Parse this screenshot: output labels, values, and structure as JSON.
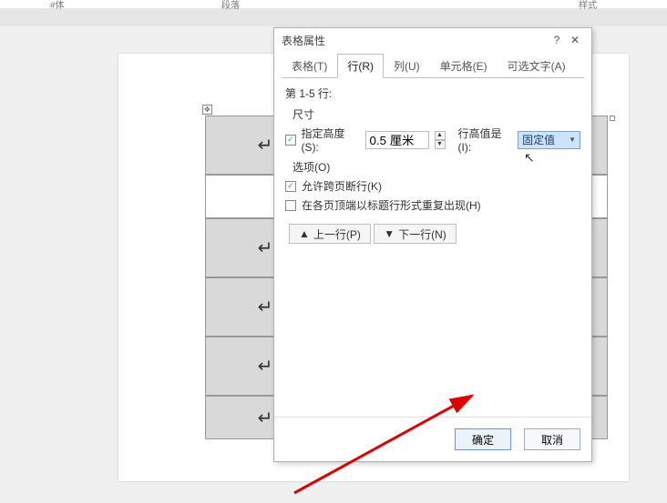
{
  "ribbon": {
    "left": "#体",
    "mid": "段落",
    "right": "样式"
  },
  "dialog": {
    "title": "表格属性",
    "help": "?",
    "tabs": {
      "table": "表格(T)",
      "row": "行(R)",
      "col": "列(U)",
      "cell": "单元格(E)",
      "alt": "可选文字(A)"
    },
    "range": "第 1-5 行:",
    "size_label": "尺寸",
    "specify_height": "指定高度(S):",
    "height_value": "0.5 厘米",
    "row_height_is": "行高值是(I):",
    "row_height_mode": "固定值",
    "options_label": "选项(O)",
    "allow_break": "允许跨页断行(K)",
    "repeat_header": "在各页顶端以标题行形式重复出现(H)",
    "prev_row": "上一行(P)",
    "next_row": "下一行(N)",
    "ok": "确定",
    "cancel": "取消"
  }
}
